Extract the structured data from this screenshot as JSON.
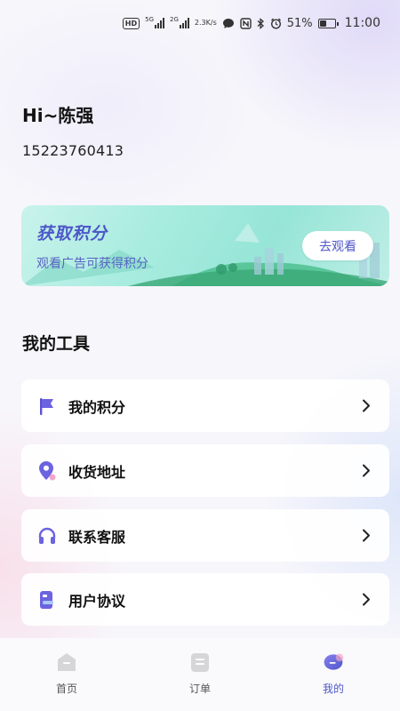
{
  "status_bar": {
    "hd": "HD",
    "sim1": "5G",
    "sim2": "2G",
    "speed_value": "2.3",
    "speed_unit": "K/s",
    "battery_percent": "51%",
    "battery_level": 0.51,
    "time": "11:00",
    "icons": [
      "hd-icon",
      "signal-5g-icon",
      "signal-2g-icon",
      "message-icon",
      "nfc-icon",
      "bluetooth-icon",
      "alarm-icon",
      "battery-icon"
    ]
  },
  "profile": {
    "greeting": "Hi~陈强",
    "phone": "15223760413"
  },
  "banner": {
    "title": "获取积分",
    "subtitle": "观看广告可获得积分",
    "button": "去观看"
  },
  "tools": {
    "title": "我的工具",
    "items": [
      {
        "label": "我的积分",
        "icon": "flag-icon"
      },
      {
        "label": "收货地址",
        "icon": "location-pin-icon"
      },
      {
        "label": "联系客服",
        "icon": "headset-icon"
      },
      {
        "label": "用户协议",
        "icon": "document-icon"
      }
    ]
  },
  "tabbar": {
    "items": [
      {
        "label": "首页",
        "icon": "home-icon"
      },
      {
        "label": "订单",
        "icon": "order-icon"
      },
      {
        "label": "我的",
        "icon": "profile-icon"
      }
    ],
    "active": "我的"
  },
  "colors": {
    "accent": "#4e57c9",
    "icon_purple": "#6b63e0",
    "banner_teal": "#a8ecdf"
  }
}
